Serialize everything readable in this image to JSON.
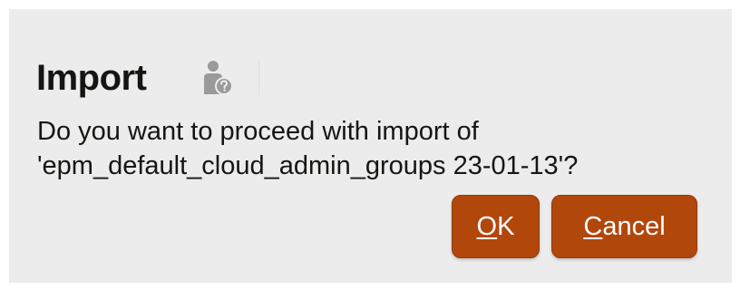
{
  "dialog": {
    "title": "Import",
    "help_icon": "user-help-icon",
    "message_line1": "Do you want to proceed with import of",
    "message_line2": "'epm_default_cloud_admin_groups 23-01-13'?"
  },
  "buttons": {
    "ok_mnemonic": "O",
    "ok_rest": "K",
    "cancel_mnemonic": "C",
    "cancel_rest": "ancel"
  },
  "colors": {
    "dialog_background": "#ececec",
    "button_accent": "#b2470c",
    "text": "#161513"
  }
}
